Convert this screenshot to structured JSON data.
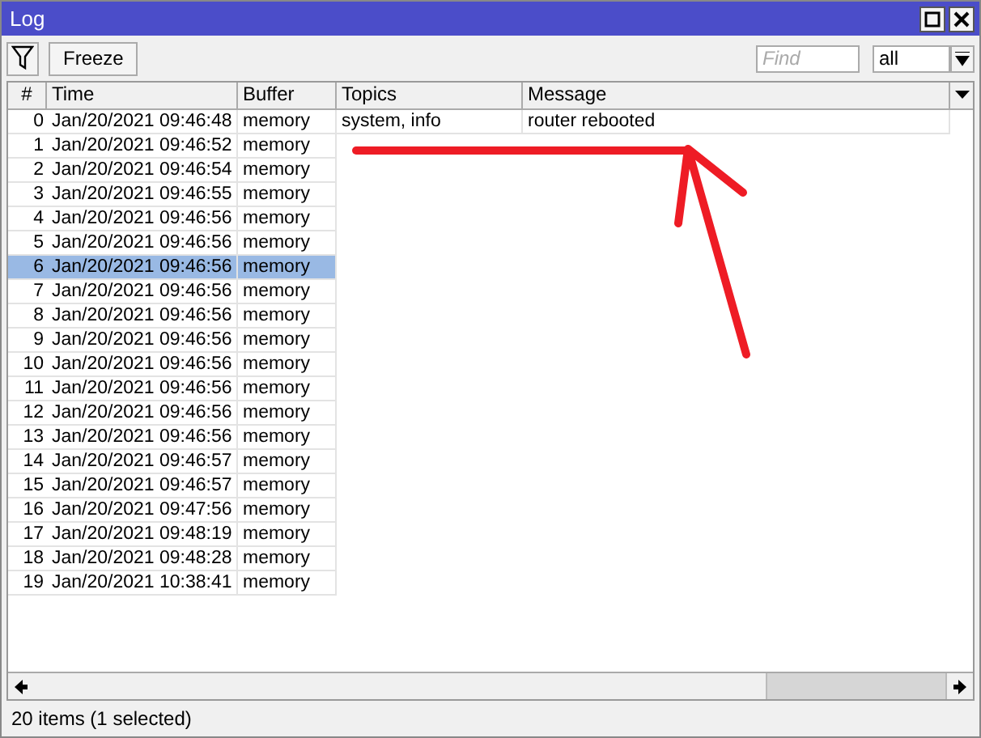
{
  "window": {
    "title": "Log"
  },
  "toolbar": {
    "freeze_label": "Freeze",
    "find": {
      "placeholder": "Find"
    },
    "buffer_select": {
      "value": "all"
    }
  },
  "table": {
    "columns": [
      "#",
      "Time",
      "Buffer",
      "Topics",
      "Message"
    ],
    "rows": [
      {
        "num": "0",
        "time": "Jan/20/2021 09:46:48",
        "buffer": "memory",
        "topics": "system, info",
        "message": "router rebooted",
        "selected": false
      },
      {
        "num": "1",
        "time": "Jan/20/2021 09:46:52",
        "buffer": "memory",
        "selected": false
      },
      {
        "num": "2",
        "time": "Jan/20/2021 09:46:54",
        "buffer": "memory",
        "selected": false
      },
      {
        "num": "3",
        "time": "Jan/20/2021 09:46:55",
        "buffer": "memory",
        "selected": false
      },
      {
        "num": "4",
        "time": "Jan/20/2021 09:46:56",
        "buffer": "memory",
        "selected": false
      },
      {
        "num": "5",
        "time": "Jan/20/2021 09:46:56",
        "buffer": "memory",
        "selected": false
      },
      {
        "num": "6",
        "time": "Jan/20/2021 09:46:56",
        "buffer": "memory",
        "selected": true
      },
      {
        "num": "7",
        "time": "Jan/20/2021 09:46:56",
        "buffer": "memory",
        "selected": false
      },
      {
        "num": "8",
        "time": "Jan/20/2021 09:46:56",
        "buffer": "memory",
        "selected": false
      },
      {
        "num": "9",
        "time": "Jan/20/2021 09:46:56",
        "buffer": "memory",
        "selected": false
      },
      {
        "num": "10",
        "time": "Jan/20/2021 09:46:56",
        "buffer": "memory",
        "selected": false
      },
      {
        "num": "11",
        "time": "Jan/20/2021 09:46:56",
        "buffer": "memory",
        "selected": false
      },
      {
        "num": "12",
        "time": "Jan/20/2021 09:46:56",
        "buffer": "memory",
        "selected": false
      },
      {
        "num": "13",
        "time": "Jan/20/2021 09:46:56",
        "buffer": "memory",
        "selected": false
      },
      {
        "num": "14",
        "time": "Jan/20/2021 09:46:57",
        "buffer": "memory",
        "selected": false
      },
      {
        "num": "15",
        "time": "Jan/20/2021 09:46:57",
        "buffer": "memory",
        "selected": false
      },
      {
        "num": "16",
        "time": "Jan/20/2021 09:47:56",
        "buffer": "memory",
        "selected": false
      },
      {
        "num": "17",
        "time": "Jan/20/2021 09:48:19",
        "buffer": "memory",
        "selected": false
      },
      {
        "num": "18",
        "time": "Jan/20/2021 09:48:28",
        "buffer": "memory",
        "selected": false
      },
      {
        "num": "19",
        "time": "Jan/20/2021 10:38:41",
        "buffer": "memory",
        "selected": false
      }
    ]
  },
  "status_bar": "20 items (1 selected)"
}
